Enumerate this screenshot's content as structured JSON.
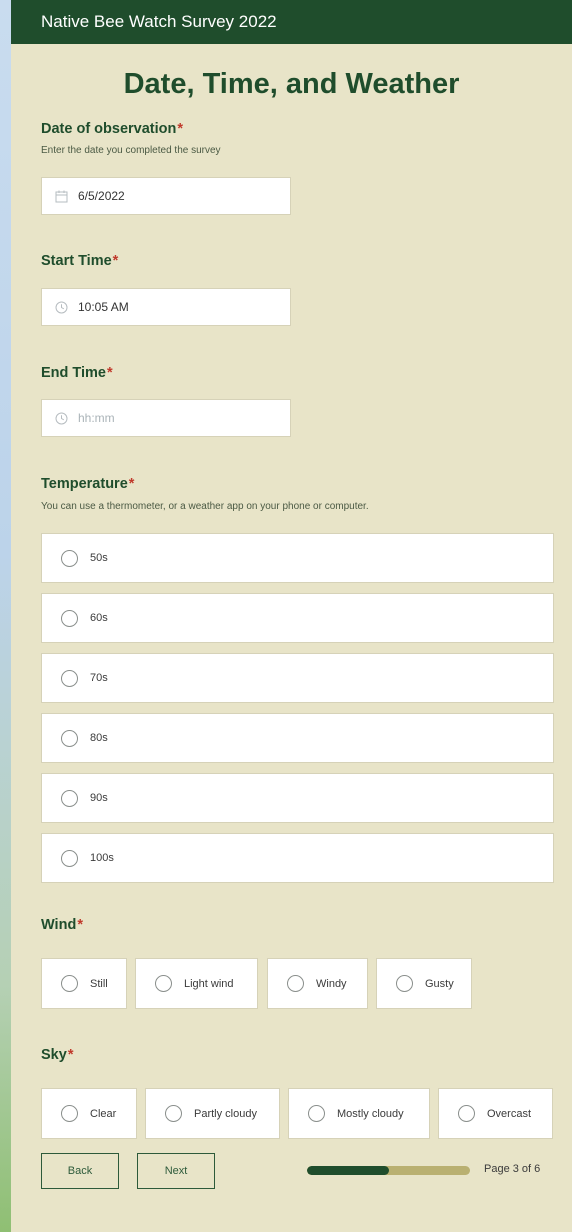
{
  "header": {
    "title": "Native Bee Watch Survey 2022"
  },
  "page": {
    "title": "Date, Time, and Weather"
  },
  "questions": {
    "date": {
      "label": "Date of observation",
      "required": "*",
      "hint": "Enter the date you completed the survey",
      "value": "6/5/2022",
      "icon": "calendar-icon"
    },
    "start": {
      "label": "Start Time",
      "required": "*",
      "value": "10:05 AM",
      "icon": "clock-icon"
    },
    "end": {
      "label": "End Time",
      "required": "*",
      "placeholder": "hh:mm",
      "icon": "clock-icon"
    },
    "temperature": {
      "label": "Temperature",
      "required": "*",
      "hint": "You can use a thermometer, or a weather app on your phone or computer.",
      "options": [
        "50s",
        "60s",
        "70s",
        "80s",
        "90s",
        "100s"
      ]
    },
    "wind": {
      "label": "Wind",
      "required": "*",
      "options": [
        "Still",
        "Light wind",
        "Windy",
        "Gusty"
      ]
    },
    "sky": {
      "label": "Sky",
      "required": "*",
      "options": [
        "Clear",
        "Partly cloudy",
        "Mostly cloudy",
        "Overcast"
      ]
    }
  },
  "nav": {
    "back": "Back",
    "next": "Next",
    "page_indicator": "Page 3 of 6",
    "progress_fraction": 0.5
  },
  "colors": {
    "header": "#1f4d2c",
    "form_bg": "#e8e4c8",
    "accent": "#1f4d2c",
    "required": "#c0392b",
    "progress_track": "#b9b071"
  }
}
